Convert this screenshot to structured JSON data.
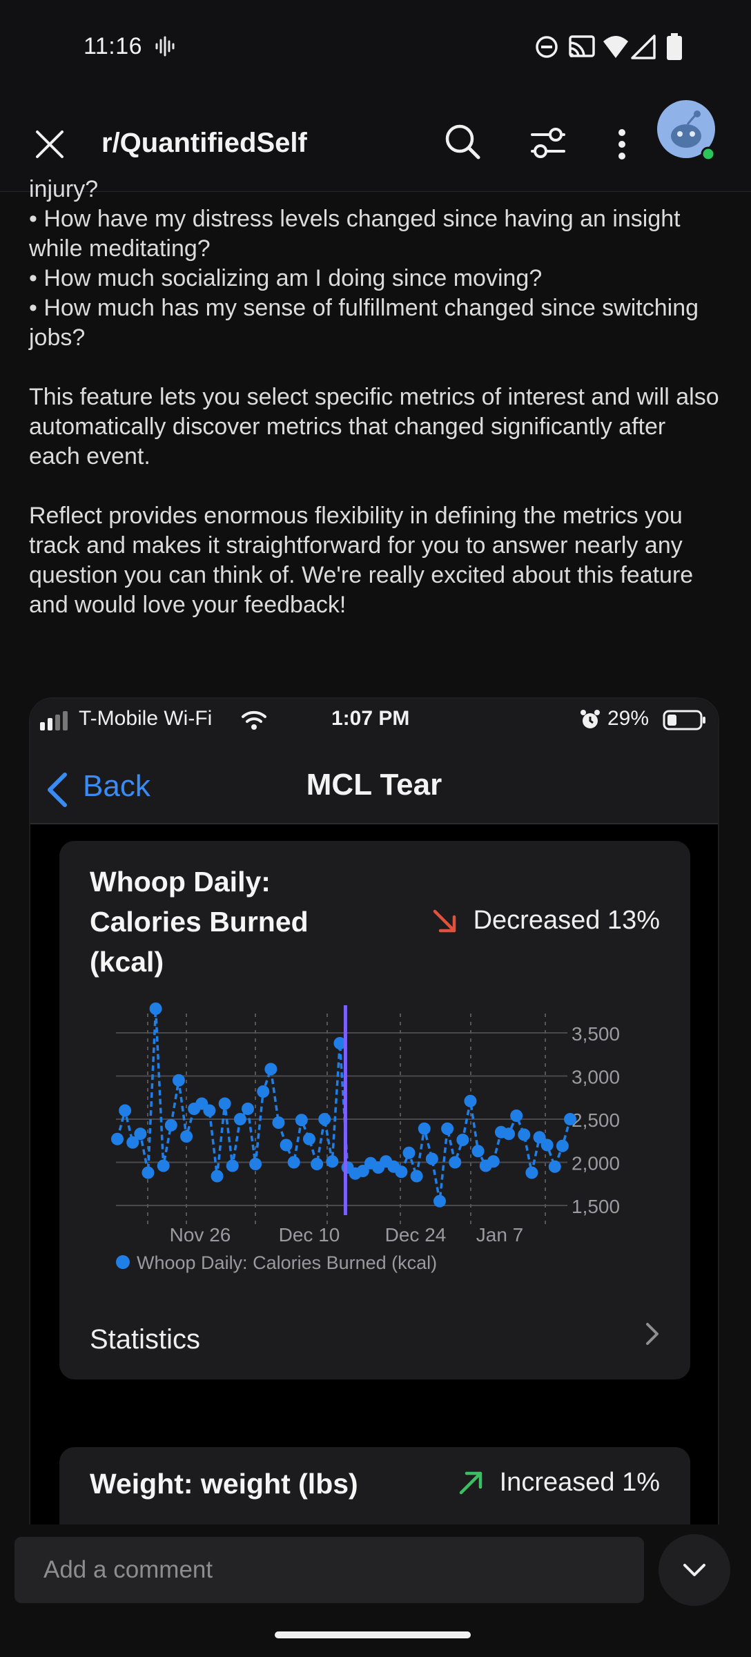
{
  "status_bar": {
    "time": "11:16"
  },
  "header": {
    "subreddit": "r/QuantifiedSelf"
  },
  "post": {
    "cut_line": "injury?",
    "bullets": [
      "• How have my distress levels changed since having an insight while meditating?",
      "• How much socializing am I doing since moving?",
      "• How much has my sense of fulfillment changed since switching jobs?"
    ],
    "paragraphs": [
      "This feature lets you select specific metrics of interest and will also automatically discover metrics that changed significantly after each event.",
      "Reflect provides enormous flexibility in defining the metrics you track and makes it straightforward for you to answer nearly any question you can think of. We're really excited about this feature and would love your feedback!"
    ]
  },
  "embed": {
    "status": {
      "carrier": "T-Mobile Wi-Fi",
      "time": "1:07 PM",
      "battery": "29%"
    },
    "nav": {
      "back_label": "Back",
      "title": "MCL Tear"
    },
    "card1": {
      "title": "Whoop Daily: Calories Burned (kcal)",
      "change": "Decreased 13%",
      "change_color": "#e0513e",
      "statistics_label": "Statistics"
    },
    "card2": {
      "title": "Weight: weight (lbs)",
      "change": "Increased 1%",
      "change_color": "#3bbf62"
    }
  },
  "chart_data": {
    "type": "line",
    "series": [
      {
        "name": "Whoop Daily: Calories Burned (kcal)",
        "color": "#1f7fe6",
        "values": [
          2270,
          2600,
          2230,
          2330,
          1880,
          3780,
          1960,
          2430,
          2950,
          2300,
          2620,
          2680,
          2600,
          1840,
          2680,
          1960,
          2500,
          2620,
          1980,
          2820,
          3080,
          2460,
          2200,
          2000,
          2490,
          2270,
          1980,
          2500,
          2010,
          3380,
          1940,
          1870,
          1900,
          1990,
          1940,
          2010,
          1950,
          1890,
          2110,
          1840,
          2390,
          2040,
          1550,
          2390,
          2000,
          2260,
          2710,
          2130,
          1960,
          2010,
          2350,
          2330,
          2540,
          2320,
          1880,
          2290,
          2200,
          1950,
          2190,
          2500
        ]
      }
    ],
    "x_tick_labels": [
      "Nov 26",
      "Dec 10",
      "Dec 24",
      "Jan 7"
    ],
    "y_tick_labels": [
      "3,500",
      "3,000",
      "2,500",
      "2,000",
      "1,500"
    ],
    "yticks": [
      3500,
      3000,
      2500,
      2000,
      1500
    ],
    "ylim": [
      1500,
      3500
    ],
    "event_index": 29,
    "event_color": "#7b61ff",
    "legend": "Whoop Daily: Calories Burned (kcal)",
    "grid": true
  }
}
